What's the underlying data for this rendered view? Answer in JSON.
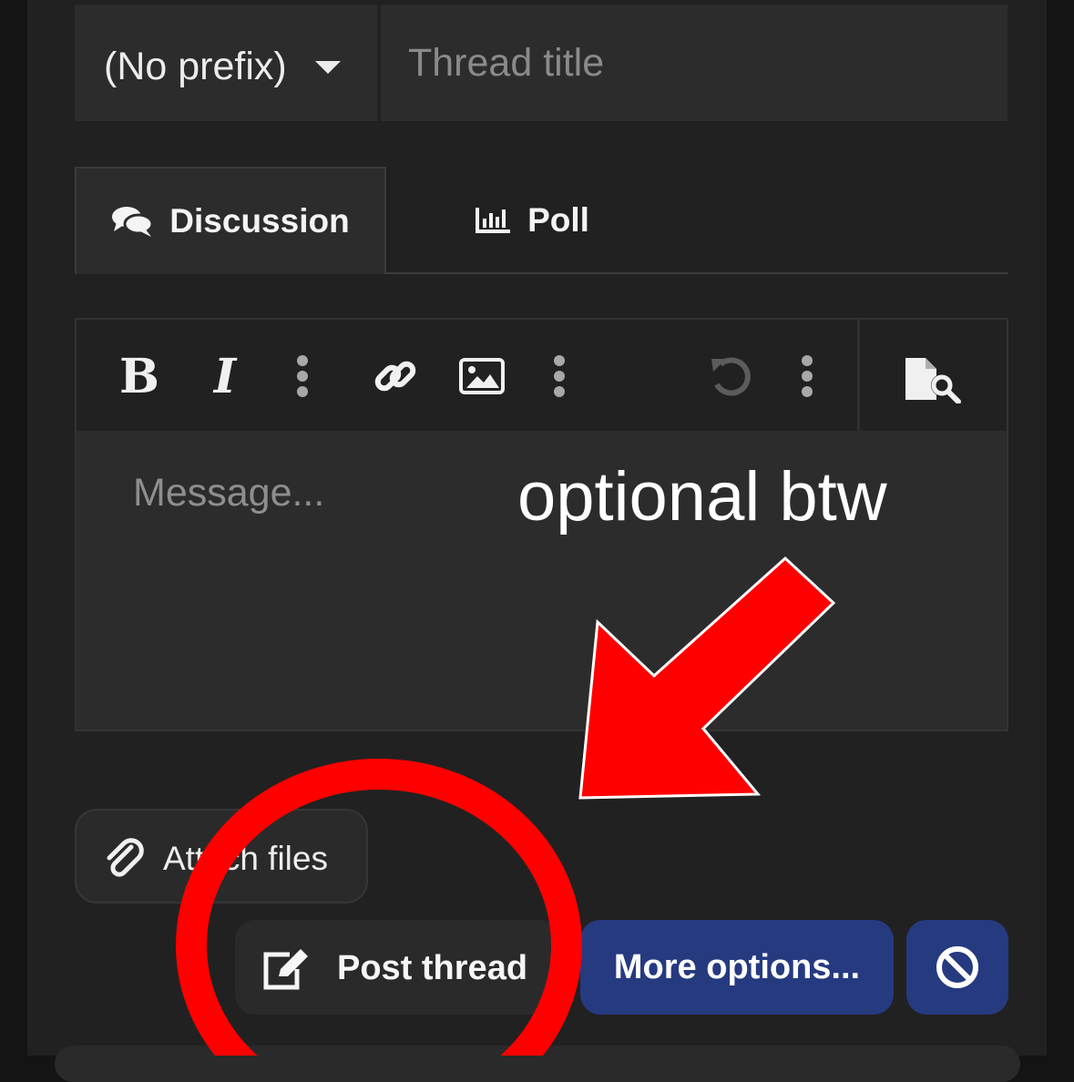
{
  "form": {
    "prefix_label": "(No prefix)",
    "title_placeholder": "Thread title"
  },
  "tabs": [
    {
      "label": "Discussion",
      "icon": "comments-icon",
      "active": true
    },
    {
      "label": "Poll",
      "icon": "chart-bar-icon",
      "active": false
    }
  ],
  "toolbar": {
    "buttons": [
      "bold-icon",
      "italic-icon",
      "more-vertical-icon",
      "link-icon",
      "image-icon",
      "more-vertical-icon",
      "undo-icon",
      "more-vertical-icon",
      "preview-icon"
    ]
  },
  "editor": {
    "message_placeholder": "Message..."
  },
  "annotation": {
    "text": "optional btw",
    "color": "#ff0000"
  },
  "actions": {
    "attach_label": "Attach files",
    "post_label": "Post thread",
    "more_label": "More options...",
    "cancel_icon": "ban-icon"
  },
  "colors": {
    "background": "#212121",
    "field": "#2c2c2c",
    "primary_button": "#263a80",
    "annotation_red": "#ff0000"
  }
}
